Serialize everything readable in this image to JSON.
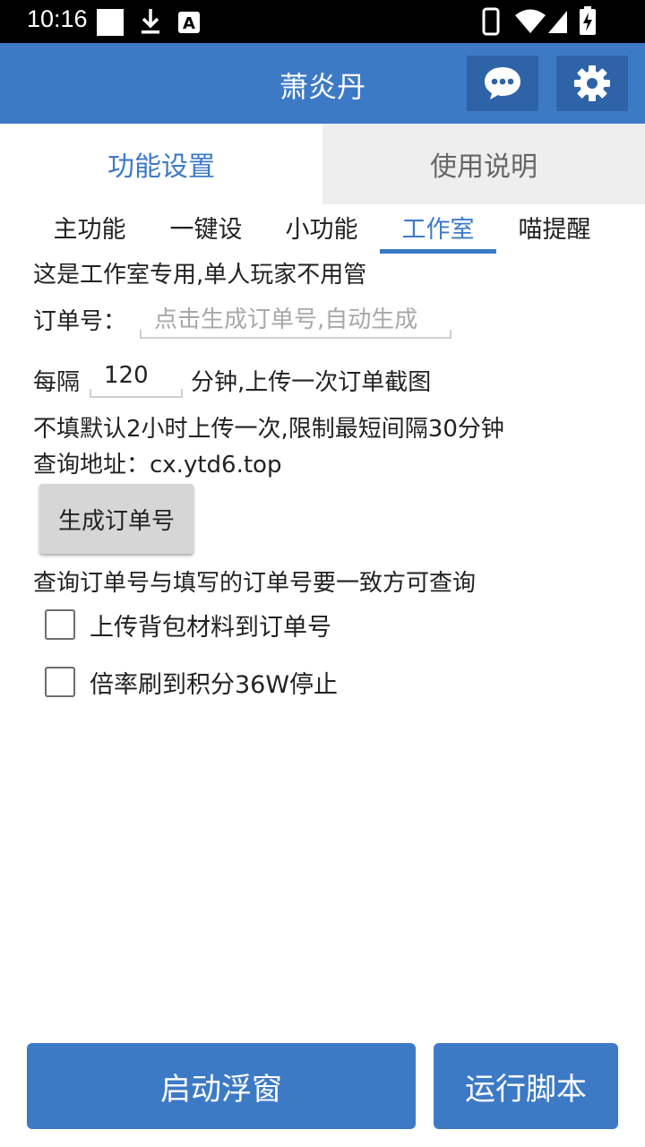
{
  "status_bar": {
    "time": "10:16",
    "icons": [
      "white-square-icon",
      "download-icon",
      "a-badge-icon",
      "phone-icon",
      "wifi-icon",
      "battery-charging-icon"
    ]
  },
  "app_bar": {
    "title": "萧炎丹",
    "chat_button_icon": "chat-bubble-icon",
    "settings_button_icon": "gear-icon",
    "color": "#3d7ac6"
  },
  "main_tabs": [
    {
      "label": "功能设置",
      "active": true
    },
    {
      "label": "使用说明",
      "active": false
    }
  ],
  "sub_tabs": [
    {
      "label": "主功能",
      "active": false
    },
    {
      "label": "一键设",
      "active": false
    },
    {
      "label": "小功能",
      "active": false
    },
    {
      "label": "工作室",
      "active": true
    },
    {
      "label": "喵提醒",
      "active": false
    }
  ],
  "content": {
    "studio_note": "这是工作室专用,单人玩家不用管",
    "order_label": "订单号：",
    "order_placeholder": "点击生成订单号,自动生成",
    "interval_prefix": "每隔",
    "interval_value": "120",
    "interval_suffix": "分钟,上传一次订单截图",
    "default_note": "不填默认2小时上传一次,限制最短间隔30分钟",
    "query_address": "查询地址：cx.ytd6.top",
    "generate_button": "生成订单号",
    "query_note": "查询订单号与填写的订单号要一致方可查询",
    "checkbox_upload": {
      "label": "上传背包材料到订单号",
      "checked": false
    },
    "checkbox_stop": {
      "label": "倍率刷到积分36W停止",
      "checked": false
    }
  },
  "bottom_buttons": {
    "float_window": "启动浮窗",
    "run_script": "运行脚本"
  }
}
